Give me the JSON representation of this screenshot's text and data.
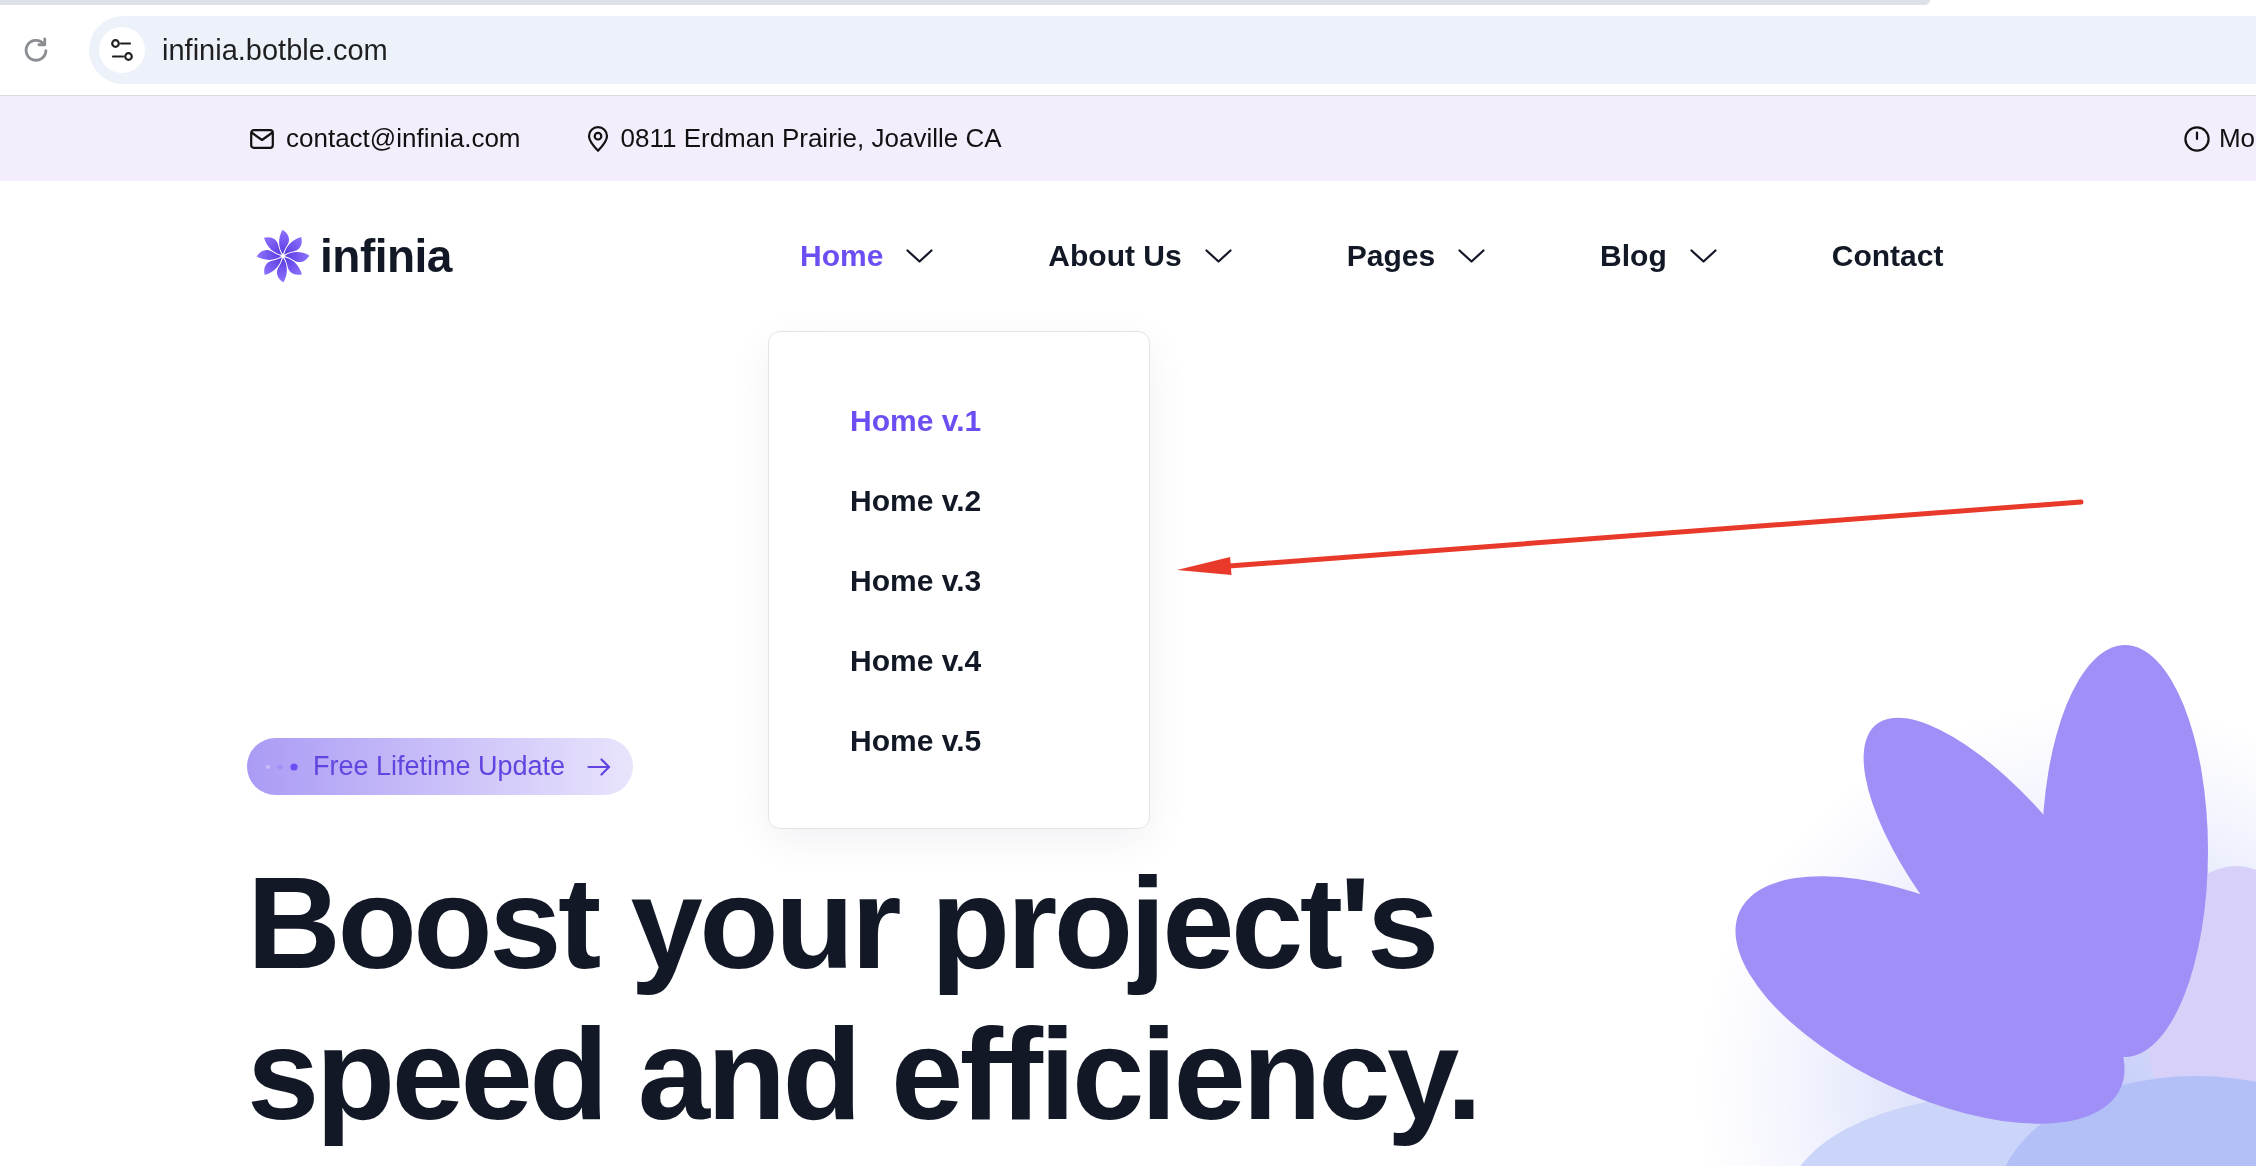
{
  "browser": {
    "url": "infinia.botble.com"
  },
  "contact_bar": [
    {
      "kind": "email",
      "text": "contact@infinia.com"
    },
    {
      "kind": "address",
      "text": "0811 Erdman Prairie, Joaville CA"
    },
    {
      "kind": "hours",
      "text": "Mo"
    }
  ],
  "header": {
    "logo": "infinia",
    "nav": [
      {
        "label": "Home",
        "selected": true,
        "dropdown": true,
        "submenu": [
          {
            "label": "Home v.1",
            "selected": true
          },
          {
            "label": "Home v.2",
            "selected": false
          },
          {
            "label": "Home v.3",
            "selected": false
          },
          {
            "label": "Home v.4",
            "selected": false
          },
          {
            "label": "Home v.5",
            "selected": false
          }
        ]
      },
      {
        "label": "About Us",
        "selected": false,
        "dropdown": true
      },
      {
        "label": "Pages",
        "selected": false,
        "dropdown": true
      },
      {
        "label": "Blog",
        "selected": false,
        "dropdown": true
      },
      {
        "label": "Contact",
        "selected": false,
        "dropdown": false
      }
    ]
  },
  "hero": {
    "badge": "Free Lifetime Update",
    "headline": "Boost your project's speed and efficiency."
  },
  "annotations": [
    {
      "kind": "arrow"
    }
  ]
}
